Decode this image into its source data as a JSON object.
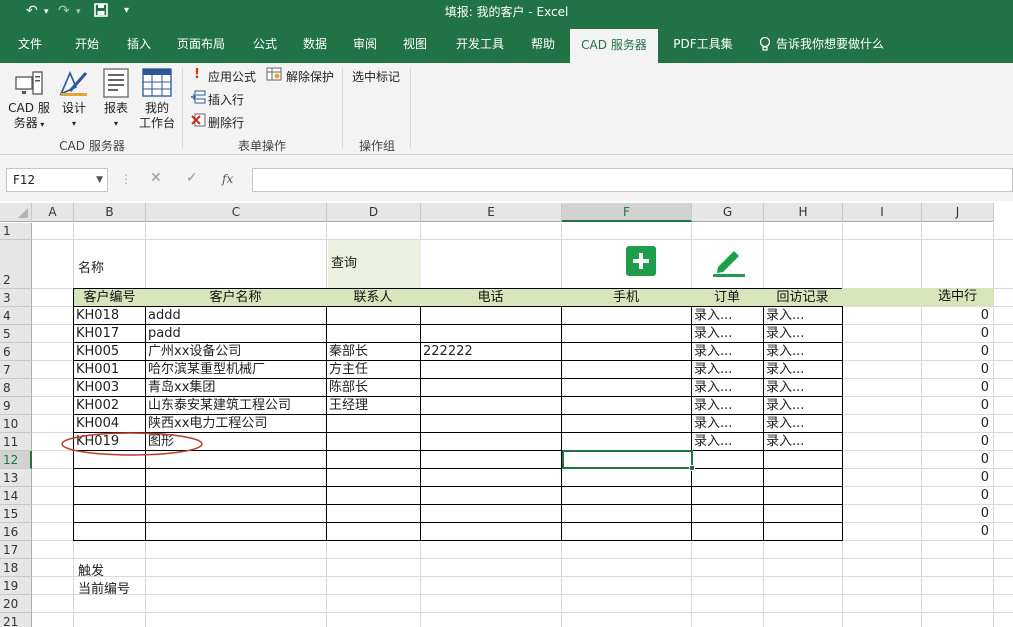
{
  "window": {
    "title": "填报: 我的客户  -  Excel"
  },
  "tabs": [
    "文件",
    "开始",
    "插入",
    "页面布局",
    "公式",
    "数据",
    "审阅",
    "视图",
    "开发工具",
    "帮助",
    "CAD 服务器",
    "PDF工具集",
    "告诉我你想要做什么"
  ],
  "ribbon": {
    "cad_server": "CAD 服",
    "cad_server2": "务器",
    "design": "设计",
    "report": "报表",
    "my_workbench": "我的",
    "my_workbench2": "工作台",
    "group1": "CAD 服务器",
    "apply_formula": "应用公式",
    "unprotect": "解除保护",
    "insert_row": "插入行",
    "delete_row": "删除行",
    "group2": "表单操作",
    "select_mark": "选中标记",
    "group3": "操作组"
  },
  "formula_bar": {
    "name_box": "F12",
    "fx": "fx",
    "formula": ""
  },
  "columns": [
    "A",
    "B",
    "C",
    "D",
    "E",
    "F",
    "G",
    "H",
    "I",
    "J"
  ],
  "rows": [
    "1",
    "2",
    "3",
    "4",
    "5",
    "6",
    "7",
    "8",
    "9",
    "10",
    "11",
    "12",
    "13",
    "14",
    "15",
    "16",
    "17",
    "18",
    "19",
    "20",
    "21"
  ],
  "labels": {
    "name": "名称",
    "query": "查询",
    "trigger": "触发",
    "current_no": "当前编号"
  },
  "table": {
    "headers": [
      "客户编号",
      "客户名称",
      "联系人",
      "电话",
      "手机",
      "订单",
      "回访记录",
      "",
      "选中行"
    ],
    "rows": [
      {
        "id": "KH018",
        "name": "addd",
        "contact": "",
        "phone": "",
        "order": "录入...",
        "visit": "录入...",
        "sel": "0"
      },
      {
        "id": "KH017",
        "name": "padd",
        "contact": "",
        "phone": "",
        "order": "录入...",
        "visit": "录入...",
        "sel": "0"
      },
      {
        "id": "KH005",
        "name": "广州xx设备公司",
        "contact": "秦部长",
        "phone": "222222",
        "order": "录入...",
        "visit": "录入...",
        "sel": "0"
      },
      {
        "id": "KH001",
        "name": "哈尔滨某重型机械厂",
        "contact": "方主任",
        "phone": "",
        "order": "录入...",
        "visit": "录入...",
        "sel": "0"
      },
      {
        "id": "KH003",
        "name": "青岛xx集团",
        "contact": "陈部长",
        "phone": "",
        "order": "录入...",
        "visit": "录入...",
        "sel": "0"
      },
      {
        "id": "KH002",
        "name": "山东泰安某建筑工程公司",
        "contact": "王经理",
        "phone": "",
        "order": "录入...",
        "visit": "录入...",
        "sel": "0"
      },
      {
        "id": "KH004",
        "name": "陕西xx电力工程公司",
        "contact": "",
        "phone": "",
        "order": "录入...",
        "visit": "录入...",
        "sel": "0"
      },
      {
        "id": "KH019",
        "name": "图形",
        "contact": "",
        "phone": "",
        "order": "录入...",
        "visit": "录入...",
        "sel": "0"
      }
    ],
    "empty_sel": [
      "0",
      "0",
      "0",
      "0",
      "0"
    ]
  },
  "colors": {
    "accent": "#217346",
    "header_fill": "#d8e4bc",
    "query_fill": "#ebf1de",
    "button_green": "#1e9e4a"
  }
}
